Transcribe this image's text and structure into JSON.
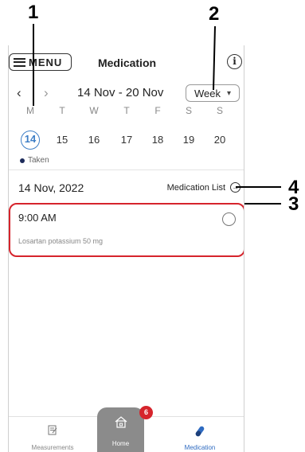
{
  "header": {
    "menu_label": "MENU",
    "title": "Medication",
    "info_icon": "i"
  },
  "week_nav": {
    "prev_icon": "‹",
    "next_icon": "›",
    "range": "14 Nov - 20 Nov",
    "view_select": "Week"
  },
  "day_letters": [
    "M",
    "T",
    "W",
    "T",
    "F",
    "S",
    "S"
  ],
  "dates": [
    "14",
    "15",
    "16",
    "17",
    "18",
    "19",
    "20"
  ],
  "selected_date_index": 0,
  "legend": {
    "label": "Taken",
    "color": "#1d2b5a"
  },
  "date_row": {
    "date": "14 Nov, 2022",
    "med_list_label": "Medication List"
  },
  "medication": {
    "time": "9:00 AM",
    "drug": "Losartan potassium 50 mg"
  },
  "tabbar": {
    "measurements_label": "Measurements",
    "home_label": "Home",
    "medication_label": "Medication",
    "home_badge": "6"
  },
  "annotations": {
    "n1": "1",
    "n2": "2",
    "n3": "3",
    "n4": "4"
  },
  "colors": {
    "accent": "#3d7ec6",
    "annotation_red": "#d6242c",
    "active_tab": "#2f6bc1"
  }
}
